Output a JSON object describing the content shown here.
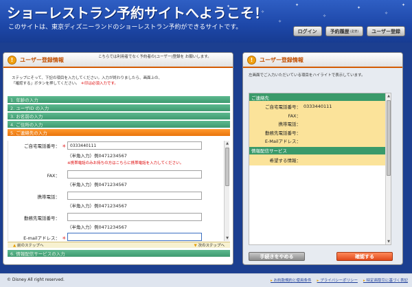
{
  "header": {
    "title": "ショーレストラン予約サイトへようこそ！",
    "subtitle": "このサイトは、東京ディズニーランドのショーレストラン予約ができるサイトです。",
    "buttons": [
      {
        "label": "ログイン"
      },
      {
        "label": "予約履歴",
        "sub": "(変更)"
      },
      {
        "label": "ユーザー登録"
      }
    ]
  },
  "left": {
    "heading": "ユーザー登録情報",
    "note": "こちらでは利用者でなく予約者の(ユーザー)登録を お願いします。",
    "intro_line1": "ステップにそって、下記の項目を入力してください。入力が終わりましたら、画面上の、",
    "intro_line2_a": "「確認する」ボタンを押してください。",
    "intro_required": "＊印は必須入力です。",
    "steps": [
      "1. 年齢の入力",
      "2. ユーザID の入力",
      "3. お名前の入力",
      "4. ご住所の入力",
      "5. ご連絡先の入力",
      "6. 情報配信サービスの入力"
    ],
    "form": {
      "home_phone_label": "ご自宅電話番号：",
      "home_phone_value": "0333440111",
      "home_phone_hint": "（半角入力）例0471234567",
      "home_phone_warn": "※携帯電話のみお持ちの方はこちらに携帯電話を入力してください。",
      "fax_label": "FAX：",
      "fax_hint": "（半角入力）例0471234567",
      "mobile_label": "携帯電話：",
      "mobile_hint": "（半角入力）例0471234567",
      "work_label": "勤務先電話番号：",
      "work_hint": "（半角入力）例0471234567",
      "email_label": "E-mailアドレス：",
      "required_mark": "＊"
    },
    "nav": {
      "prev": "前のステップへ",
      "next": "次のステップへ"
    }
  },
  "right": {
    "heading": "ユーザー登録情報",
    "sub": "左画面でご入力いただいている項目をハイライトで表示しています。",
    "section1": "ご連絡先",
    "rows": [
      {
        "k": "ご自宅電話番号：",
        "v": "0333440111"
      },
      {
        "k": "FAX：",
        "v": ""
      },
      {
        "k": "携帯電話：",
        "v": ""
      },
      {
        "k": "勤務先電話番号：",
        "v": ""
      },
      {
        "k": "E-Mailアドレス：",
        "v": ""
      }
    ],
    "section2": "情報配信サービス",
    "rows2": [
      {
        "k": "希望する情報：",
        "v": ""
      }
    ],
    "cancel": "手続きをやめる",
    "confirm": "確認する"
  },
  "footer": {
    "copyright": "© Disney All right reserved.",
    "links": [
      "お約款規約と使用条件",
      "プライバシーポリシー",
      "特定商取引に基づく表記"
    ]
  }
}
